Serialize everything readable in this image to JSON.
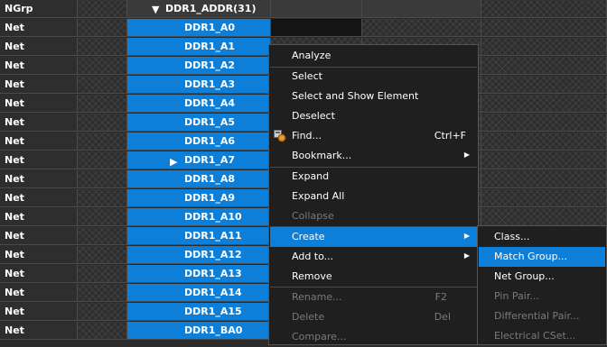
{
  "header": {
    "col0": "NGrp",
    "group_title": "DDR1_ADDR(31)"
  },
  "rows": [
    {
      "type": "Net",
      "name": "DDR1_A0"
    },
    {
      "type": "Net",
      "name": "DDR1_A1"
    },
    {
      "type": "Net",
      "name": "DDR1_A2"
    },
    {
      "type": "Net",
      "name": "DDR1_A3"
    },
    {
      "type": "Net",
      "name": "DDR1_A4"
    },
    {
      "type": "Net",
      "name": "DDR1_A5"
    },
    {
      "type": "Net",
      "name": "DDR1_A6"
    },
    {
      "type": "Net",
      "name": "DDR1_A7"
    },
    {
      "type": "Net",
      "name": "DDR1_A8"
    },
    {
      "type": "Net",
      "name": "DDR1_A9"
    },
    {
      "type": "Net",
      "name": "DDR1_A10"
    },
    {
      "type": "Net",
      "name": "DDR1_A11"
    },
    {
      "type": "Net",
      "name": "DDR1_A12"
    },
    {
      "type": "Net",
      "name": "DDR1_A13"
    },
    {
      "type": "Net",
      "name": "DDR1_A14"
    },
    {
      "type": "Net",
      "name": "DDR1_A15"
    },
    {
      "type": "Net",
      "name": "DDR1_BA0"
    }
  ],
  "context_menu": {
    "analyze": "Analyze",
    "select": "Select",
    "select_show": "Select and Show Element",
    "deselect": "Deselect",
    "find": "Find...",
    "find_shortcut": "Ctrl+F",
    "bookmark": "Bookmark...",
    "expand": "Expand",
    "expand_all": "Expand All",
    "collapse": "Collapse",
    "create": "Create",
    "add_to": "Add to...",
    "remove": "Remove",
    "rename": "Rename...",
    "rename_shortcut": "F2",
    "delete": "Delete",
    "delete_shortcut": "Del",
    "compare": "Compare..."
  },
  "create_submenu": {
    "class": "Class...",
    "match_group": "Match Group...",
    "net_group": "Net Group...",
    "pin_pair": "Pin Pair...",
    "differential_pair": "Differential Pair...",
    "electrical_cset": "Electrical CSet..."
  },
  "colors": {
    "selection": "#0e7fd9",
    "menu_bg": "#1f1f1f",
    "disabled_text": "#7a7a7a"
  }
}
